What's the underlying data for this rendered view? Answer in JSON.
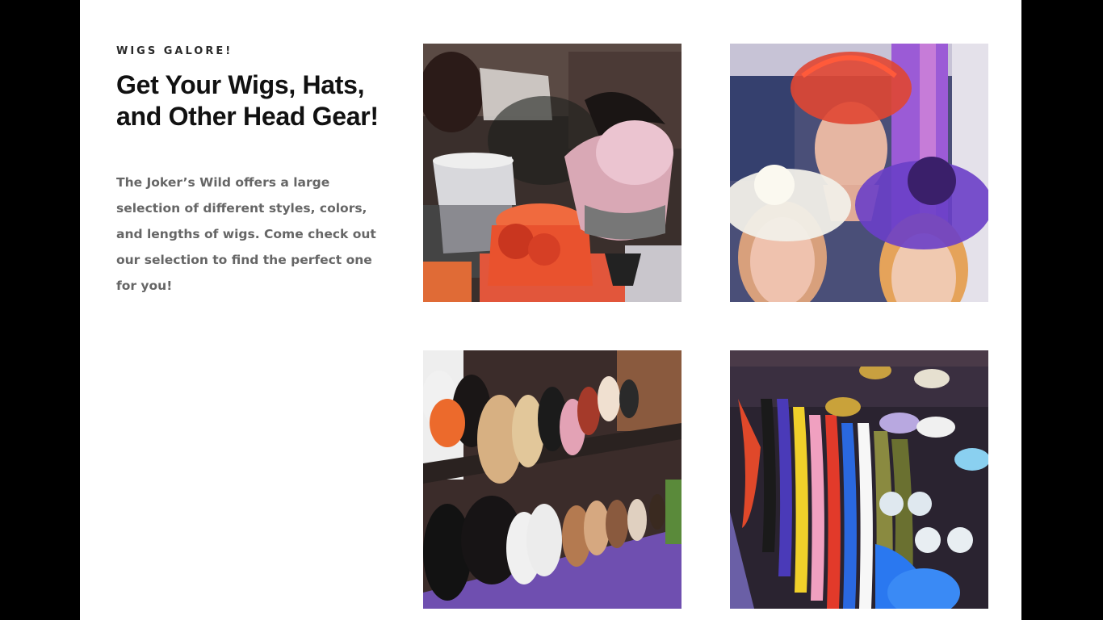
{
  "section": {
    "eyebrow": "WIGS GALORE!",
    "heading": "Get Your Wigs, Hats, and Other Head Gear!",
    "body": "The Joker’s Wild offers a large selection of different styles, colors, and lengths of wigs. Come check out our selection to find the perfect one for you!"
  },
  "gallery": {
    "photos": [
      {
        "subject": "top hats display"
      },
      {
        "subject": "fascinators on mannequin heads"
      },
      {
        "subject": "wig wall shelves"
      },
      {
        "subject": "feather boas and masquerade masks"
      }
    ]
  },
  "colors": {
    "page_background": "#ffffff",
    "outer_background": "#000000",
    "heading": "#111111",
    "body_text": "#666666"
  }
}
